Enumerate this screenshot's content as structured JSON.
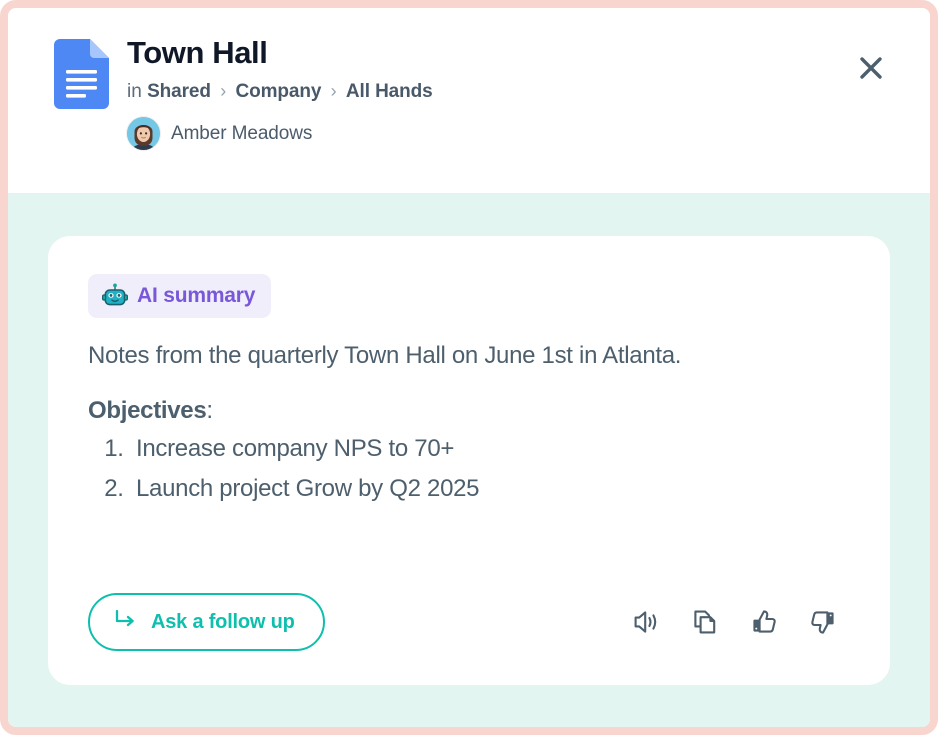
{
  "header": {
    "doc_icon": "google-docs-icon",
    "title": "Town Hall",
    "breadcrumb": {
      "prefix": "in",
      "items": [
        "Shared",
        "Company",
        "All Hands"
      ],
      "separator": "›"
    },
    "author": {
      "name": "Amber Meadows",
      "avatar": "user-avatar"
    },
    "close_icon": "close-icon"
  },
  "card": {
    "badge": {
      "icon": "robot-icon",
      "label": "AI summary",
      "background": "#f0eefb",
      "text_color": "#7857d8"
    },
    "summary": "Notes from the quarterly Town Hall on June 1st in Atlanta.",
    "objectives_heading_bold": "Objectives",
    "objectives_heading_suffix": ":",
    "objectives": [
      "Increase company NPS to 70+",
      "Launch project Grow by Q2 2025"
    ],
    "followup_button": {
      "label": "Ask a follow up",
      "icon": "corner-down-right-arrow-icon",
      "color": "#0fbfae"
    },
    "actions": [
      {
        "name": "read-aloud-icon",
        "label": "Read aloud"
      },
      {
        "name": "copy-icon",
        "label": "Copy"
      },
      {
        "name": "thumbs-up-icon",
        "label": "Good response"
      },
      {
        "name": "thumbs-down-icon",
        "label": "Bad response"
      }
    ]
  },
  "colors": {
    "window_border": "#f8d6cf",
    "body_background": "#e3f5f0",
    "card_background": "#ffffff",
    "title_color": "#101828",
    "text_color": "#4d5f6d",
    "accent_teal": "#0fbfae",
    "accent_purple": "#7857d8"
  }
}
